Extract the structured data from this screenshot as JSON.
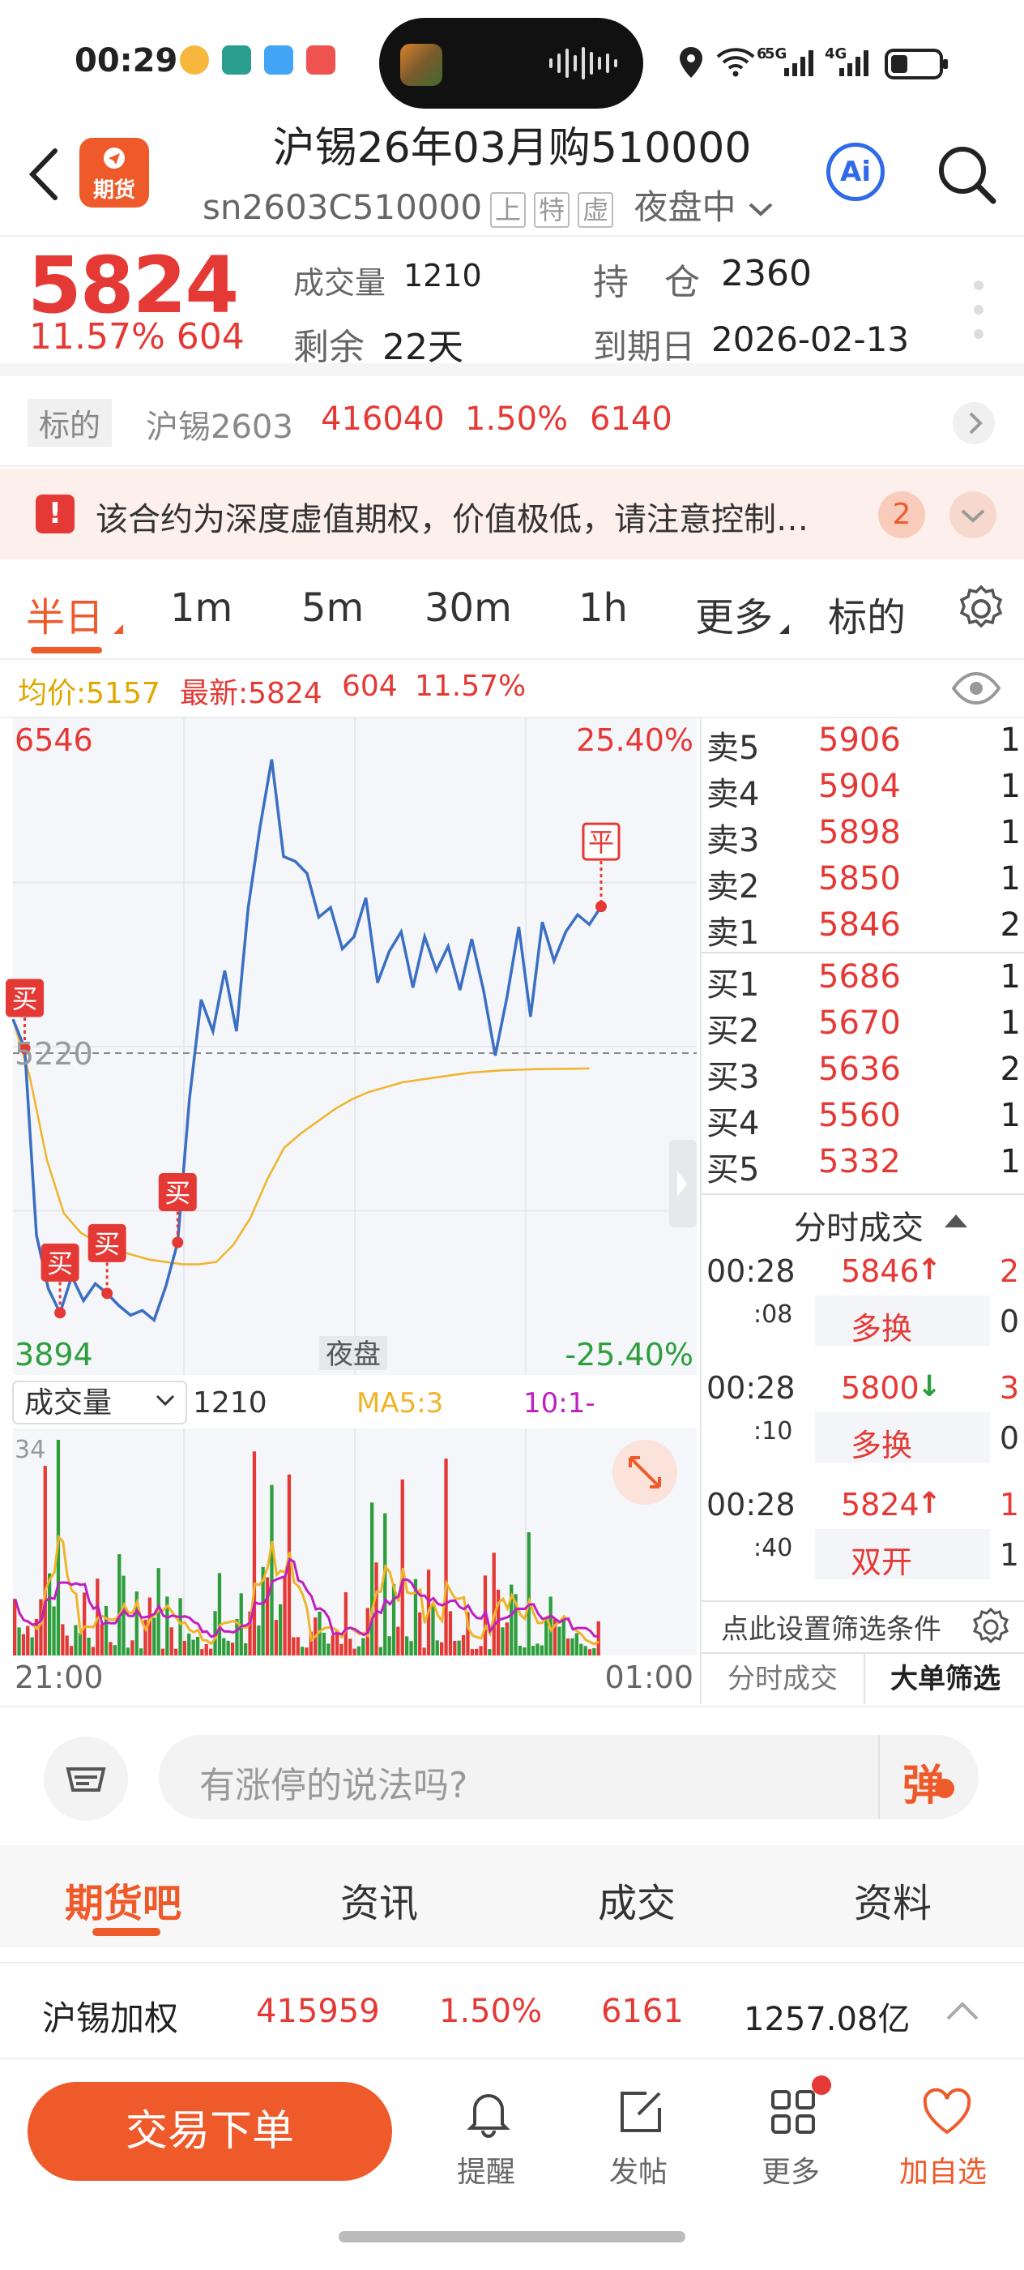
{
  "status_bar": {
    "time": "00:29",
    "network": [
      "6",
      "5G",
      "4G"
    ]
  },
  "header": {
    "title": "沪锡26年03月购510000",
    "code": "sn2603C510000",
    "tags": [
      "上",
      "特",
      "虚"
    ],
    "session": "夜盘中",
    "ai_label": "Ai",
    "logo_text": "期货"
  },
  "quote": {
    "price": "5824",
    "change_pct": "11.57%",
    "change": "604",
    "volume_label": "成交量",
    "volume": "1210",
    "oi_label": "持　仓",
    "oi": "2360",
    "remain_label": "剩余",
    "remain": "22天",
    "expiry_label": "到期日",
    "expiry": "2026-02-13"
  },
  "underlying": {
    "tag": "标的",
    "name": "沪锡2603",
    "price": "416040",
    "pct": "1.50%",
    "change": "6140"
  },
  "warning": {
    "text": "该合约为深度虚值期权，价值极低，请注意控制…",
    "count": "2"
  },
  "period_tabs": [
    "半日",
    "1m",
    "5m",
    "30m",
    "1h",
    "更多",
    "标的"
  ],
  "info_line": {
    "avg": "均价:5157",
    "latest": "最新:5824",
    "chg": "604",
    "pct": "11.57%"
  },
  "chart_data": {
    "type": "line",
    "title": "",
    "x": [
      "21:00",
      "01:00"
    ],
    "ylim": [
      3894,
      6546
    ],
    "y_labels": {
      "top": "6546",
      "bottom": "3894",
      "ref": "5220",
      "top_pct": "25.40%",
      "bottom_pct": "-25.40%"
    },
    "center_label": "夜盘",
    "series": [
      {
        "name": "",
        "color": "#3a6fc4",
        "values": [
          5360,
          5240,
          4470,
          4250,
          4150,
          4300,
          4200,
          4270,
          4230,
          4180,
          4140,
          4160,
          4120,
          4260,
          4440,
          5030,
          5440,
          5310,
          5560,
          5310,
          5820,
          6150,
          6430,
          6030,
          6010,
          5960,
          5780,
          5820,
          5650,
          5700,
          5860,
          5510,
          5640,
          5720,
          5490,
          5700,
          5560,
          5660,
          5480,
          5690,
          5480,
          5210,
          5450,
          5740,
          5370,
          5760,
          5600,
          5720,
          5790,
          5750,
          5824
        ]
      },
      {
        "name": "",
        "color": "#f0b429",
        "values": [
          5360,
          5120,
          4780,
          4560,
          4480,
          4440,
          4410,
          4390,
          4370,
          4360,
          4350,
          4350,
          4360,
          4430,
          4540,
          4700,
          4830,
          4890,
          4940,
          4990,
          5030,
          5060,
          5080,
          5100,
          5110,
          5120,
          5130,
          5140,
          5145,
          5150,
          5152,
          5154,
          5155,
          5156,
          5157
        ]
      }
    ],
    "trade_markers": [
      "买",
      "买",
      "买",
      "买",
      "平"
    ],
    "volume_panel": {
      "label": "成交量",
      "value": "1210",
      "ma5": "MA5:3",
      "ma10": "10:1-",
      "max": "34"
    }
  },
  "order_book": {
    "asks": [
      {
        "l": "卖5",
        "p": "5906",
        "v": "1"
      },
      {
        "l": "卖4",
        "p": "5904",
        "v": "1"
      },
      {
        "l": "卖3",
        "p": "5898",
        "v": "1"
      },
      {
        "l": "卖2",
        "p": "5850",
        "v": "1"
      },
      {
        "l": "卖1",
        "p": "5846",
        "v": "2"
      }
    ],
    "bids": [
      {
        "l": "买1",
        "p": "5686",
        "v": "1"
      },
      {
        "l": "买2",
        "p": "5670",
        "v": "1"
      },
      {
        "l": "买3",
        "p": "5636",
        "v": "2"
      },
      {
        "l": "买4",
        "p": "5560",
        "v": "1"
      },
      {
        "l": "买5",
        "p": "5332",
        "v": "1"
      }
    ],
    "ticks_title": "分时成交",
    "ticks": [
      {
        "t": "00:28",
        "s": ":08",
        "p": "5846",
        "dir": "↑",
        "v": "2",
        "tag": "多换",
        "tv": "0"
      },
      {
        "t": "00:28",
        "s": ":10",
        "p": "5800",
        "dir": "↓",
        "v": "3",
        "tag": "多换",
        "tv": "0"
      },
      {
        "t": "00:28",
        "s": ":40",
        "p": "5824",
        "dir": "↑",
        "v": "1",
        "tag": "双开",
        "tv": "1"
      }
    ],
    "filter": "点此设置筛选条件",
    "tab_a": "分时成交",
    "tab_b": "大单筛选"
  },
  "comment": {
    "placeholder": "有涨停的说法吗?",
    "danmu": "弹"
  },
  "bottom_tabs": [
    "期货吧",
    "资讯",
    "成交",
    "资料"
  ],
  "index_row": {
    "name": "沪锡加权",
    "price": "415959",
    "pct": "1.50%",
    "change": "6161",
    "amount": "1257.08亿"
  },
  "actions": {
    "trade": "交易下单",
    "remind": "提醒",
    "post": "发帖",
    "more": "更多",
    "watch": "加自选"
  }
}
